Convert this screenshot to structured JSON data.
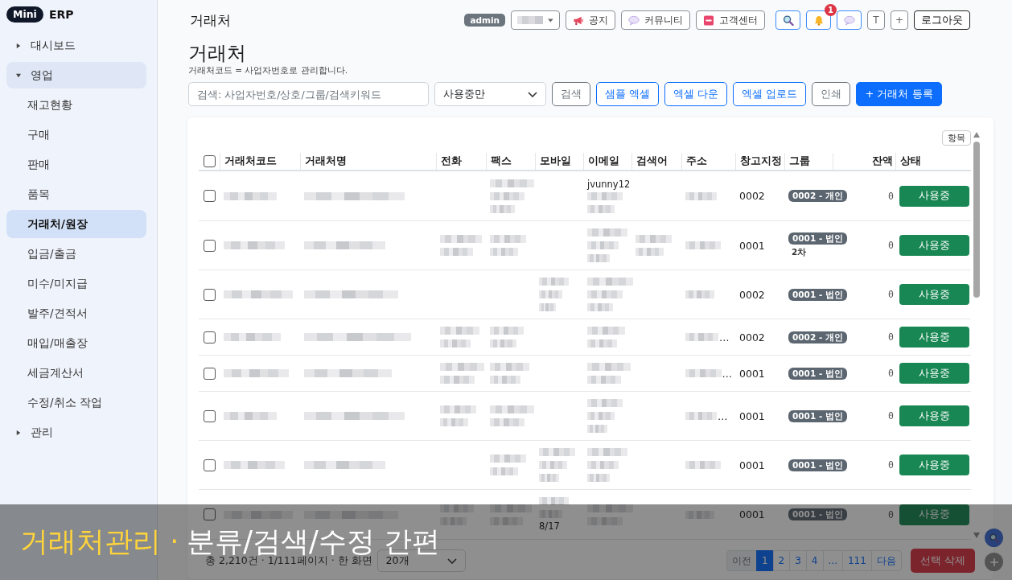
{
  "sidebar": {
    "logo": {
      "badge": "Mini",
      "name": "ERP"
    },
    "items": [
      {
        "label": "대시보드",
        "expanded": false,
        "selected": false
      },
      {
        "label": "영업",
        "expanded": true,
        "selected": false,
        "children": [
          {
            "label": "재고현황",
            "selected": false
          },
          {
            "label": "구매",
            "selected": false
          },
          {
            "label": "판매",
            "selected": false
          },
          {
            "label": "품목",
            "selected": false
          },
          {
            "label": "거래처/원장",
            "selected": true
          },
          {
            "label": "입금/출금",
            "selected": false
          },
          {
            "label": "미수/미지급",
            "selected": false
          },
          {
            "label": "발주/견적서",
            "selected": false
          },
          {
            "label": "매입/매출장",
            "selected": false
          },
          {
            "label": "세금계산서",
            "selected": false
          },
          {
            "label": "수정/취소 작업",
            "selected": false
          }
        ]
      },
      {
        "label": "관리",
        "expanded": false,
        "selected": false
      }
    ]
  },
  "topbar": {
    "title": "거래처",
    "role_badge": "admin",
    "buttons": [
      {
        "kind": "account"
      },
      {
        "kind": "notice",
        "label": "공지"
      },
      {
        "kind": "community",
        "label": "커뮤니티"
      },
      {
        "kind": "support",
        "label": "고객센터"
      },
      {
        "kind": "search"
      },
      {
        "kind": "alerts",
        "count": "1"
      },
      {
        "kind": "chat"
      },
      {
        "kind": "plain",
        "label": "T"
      },
      {
        "kind": "plain",
        "label": "+"
      },
      {
        "kind": "strong",
        "label": "로그아웃"
      }
    ]
  },
  "page": {
    "title": "거래처",
    "subtitle": "거래처코드 = 사업자번호로 관리합니다."
  },
  "toolbar": {
    "search": {
      "placeholder": "검색: 사업자번호/상호/그룹/검색키워드"
    },
    "filter": {
      "value": "사용중만"
    },
    "buttons": [
      {
        "kind": "secondary",
        "label": "검색"
      },
      {
        "kind": "outline",
        "label": "샘플 엑셀"
      },
      {
        "kind": "outline",
        "label": "엑셀 다운"
      },
      {
        "kind": "outline",
        "label": "엑셀 업로드"
      },
      {
        "kind": "secondary",
        "label": "인쇄"
      },
      {
        "kind": "primary",
        "label": "+ 거래처 등록"
      }
    ]
  },
  "table": {
    "columns_button": "항목",
    "select_all": {
      "checked": false
    },
    "columns": [
      {
        "label": "거래처코드",
        "kind": "text"
      },
      {
        "label": "거래처명",
        "kind": "text"
      },
      {
        "label": "전화",
        "kind": "text"
      },
      {
        "label": "팩스",
        "kind": "text"
      },
      {
        "label": "모바일",
        "kind": "text"
      },
      {
        "label": "이메일",
        "kind": "text"
      },
      {
        "label": "검색어",
        "kind": "text"
      },
      {
        "label": "주소",
        "kind": "text"
      },
      {
        "label": "창고지정",
        "kind": "text"
      },
      {
        "label": "그룹",
        "kind": "text"
      },
      {
        "label": "잔액",
        "kind": "number"
      },
      {
        "label": "상태",
        "kind": "text"
      }
    ],
    "rows": [
      {
        "checked": false,
        "cells": [
          {
            "kind": "line"
          },
          {
            "kind": "line"
          },
          {
            "kind": "empty"
          },
          {
            "kind": "stack"
          },
          {
            "kind": "empty"
          },
          {
            "kind": "pair",
            "text_above": "jvunny12"
          },
          {
            "kind": "empty"
          },
          {
            "kind": "line"
          },
          {
            "kind": "text",
            "text": "0002"
          },
          {
            "kind": "badge",
            "text": "0002 - 개인"
          },
          {
            "kind": "text",
            "text": "0"
          },
          {
            "kind": "button",
            "text": "사용중",
            "active": true
          }
        ]
      },
      {
        "checked": false,
        "cells": [
          {
            "kind": "line"
          },
          {
            "kind": "line"
          },
          {
            "kind": "pair"
          },
          {
            "kind": "pair"
          },
          {
            "kind": "empty"
          },
          {
            "kind": "stack"
          },
          {
            "kind": "pair"
          },
          {
            "kind": "line"
          },
          {
            "kind": "text",
            "text": "0001"
          },
          {
            "kind": "badge",
            "text": "0001 - 법인",
            "note": "2차"
          },
          {
            "kind": "text",
            "text": "0"
          },
          {
            "kind": "button",
            "text": "사용중",
            "active": true
          }
        ]
      },
      {
        "checked": false,
        "cells": [
          {
            "kind": "line"
          },
          {
            "kind": "line"
          },
          {
            "kind": "empty"
          },
          {
            "kind": "empty"
          },
          {
            "kind": "stack"
          },
          {
            "kind": "stack"
          },
          {
            "kind": "empty"
          },
          {
            "kind": "line"
          },
          {
            "kind": "text",
            "text": "0002"
          },
          {
            "kind": "badge",
            "text": "0001 - 법인"
          },
          {
            "kind": "text",
            "text": "0"
          },
          {
            "kind": "button",
            "text": "사용중",
            "active": true
          }
        ]
      },
      {
        "checked": false,
        "cells": [
          {
            "kind": "line"
          },
          {
            "kind": "line"
          },
          {
            "kind": "pair"
          },
          {
            "kind": "pair"
          },
          {
            "kind": "empty"
          },
          {
            "kind": "pair"
          },
          {
            "kind": "empty"
          },
          {
            "kind": "line",
            "suffix": "…"
          },
          {
            "kind": "text",
            "text": "0002"
          },
          {
            "kind": "badge",
            "text": "0002 - 개인"
          },
          {
            "kind": "text",
            "text": "0"
          },
          {
            "kind": "button",
            "text": "사용중",
            "active": true
          }
        ]
      },
      {
        "checked": false,
        "cells": [
          {
            "kind": "line"
          },
          {
            "kind": "line"
          },
          {
            "kind": "pair"
          },
          {
            "kind": "pair"
          },
          {
            "kind": "empty"
          },
          {
            "kind": "pair"
          },
          {
            "kind": "empty"
          },
          {
            "kind": "line",
            "suffix": "…"
          },
          {
            "kind": "text",
            "text": "0001"
          },
          {
            "kind": "badge",
            "text": "0001 - 법인"
          },
          {
            "kind": "text",
            "text": "0"
          },
          {
            "kind": "button",
            "text": "사용중",
            "active": true
          }
        ]
      },
      {
        "checked": false,
        "cells": [
          {
            "kind": "line"
          },
          {
            "kind": "line"
          },
          {
            "kind": "pair"
          },
          {
            "kind": "pair"
          },
          {
            "kind": "empty"
          },
          {
            "kind": "stack"
          },
          {
            "kind": "empty"
          },
          {
            "kind": "line",
            "suffix": "…"
          },
          {
            "kind": "text",
            "text": "0001"
          },
          {
            "kind": "badge",
            "text": "0001 - 법인"
          },
          {
            "kind": "text",
            "text": "0"
          },
          {
            "kind": "button",
            "text": "사용중",
            "active": true
          }
        ]
      },
      {
        "checked": false,
        "cells": [
          {
            "kind": "line"
          },
          {
            "kind": "line"
          },
          {
            "kind": "empty"
          },
          {
            "kind": "pair"
          },
          {
            "kind": "stack"
          },
          {
            "kind": "stack"
          },
          {
            "kind": "empty"
          },
          {
            "kind": "line"
          },
          {
            "kind": "text",
            "text": "0001"
          },
          {
            "kind": "badge",
            "text": "0001 - 법인"
          },
          {
            "kind": "text",
            "text": "0"
          },
          {
            "kind": "button",
            "text": "사용중",
            "active": true
          }
        ]
      },
      {
        "checked": false,
        "cells": [
          {
            "kind": "line"
          },
          {
            "kind": "line"
          },
          {
            "kind": "pair"
          },
          {
            "kind": "pair"
          },
          {
            "kind": "pair",
            "text_below": "8/17"
          },
          {
            "kind": "pair"
          },
          {
            "kind": "empty"
          },
          {
            "kind": "line"
          },
          {
            "kind": "text",
            "text": "0001"
          },
          {
            "kind": "badge",
            "text": "0001 - 법인"
          },
          {
            "kind": "text",
            "text": "0"
          },
          {
            "kind": "button",
            "text": "사용중",
            "active": true
          }
        ]
      }
    ]
  },
  "footer": {
    "summary": "총 2,210건 · 1/111페이지 · 한 화면",
    "page_size": "20개",
    "pagination": [
      {
        "label": "이전",
        "selected": false,
        "disabled": true
      },
      {
        "label": "1",
        "selected": true,
        "disabled": false
      },
      {
        "label": "2",
        "selected": false,
        "disabled": false
      },
      {
        "label": "3",
        "selected": false,
        "disabled": false
      },
      {
        "label": "4",
        "selected": false,
        "disabled": false
      },
      {
        "label": "...",
        "selected": false,
        "disabled": false
      },
      {
        "label": "111",
        "selected": false,
        "disabled": false
      },
      {
        "label": "다음",
        "selected": false,
        "disabled": false
      }
    ],
    "delete_button": "선택 삭제"
  },
  "floating_buttons": [
    {
      "kind": "search"
    },
    {
      "kind": "add"
    }
  ],
  "banner": {
    "title": "거래처관리 ·",
    "caption": "분류/검색/수정 간편"
  }
}
